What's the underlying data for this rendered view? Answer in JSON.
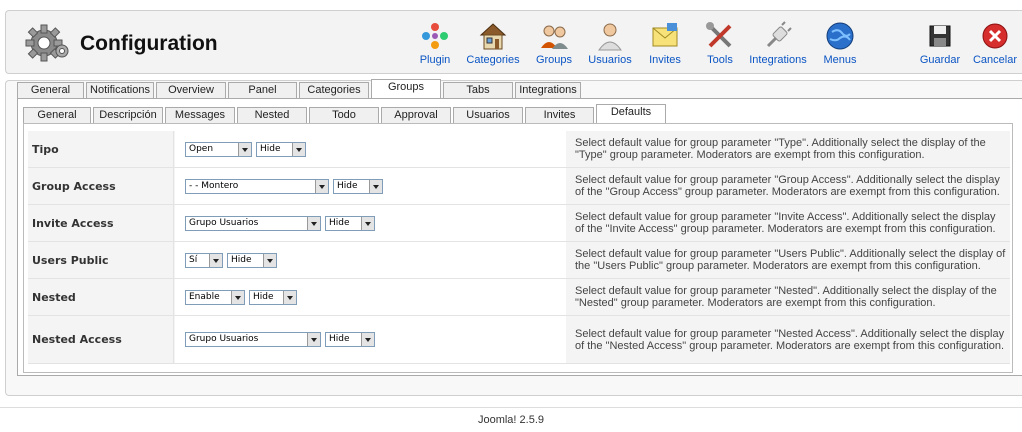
{
  "app": {
    "title": "Configuration",
    "footer": "Joomla! 2.5.9"
  },
  "toolbar": [
    {
      "label": "Plugin",
      "icon": "plugin-icon"
    },
    {
      "label": "Categories",
      "icon": "categories-icon"
    },
    {
      "label": "Groups",
      "icon": "groups-icon"
    },
    {
      "label": "Usuarios",
      "icon": "users-icon"
    },
    {
      "label": "Invites",
      "icon": "invites-icon"
    },
    {
      "label": "Tools",
      "icon": "tools-icon"
    },
    {
      "label": "Integrations",
      "icon": "integrations-icon"
    },
    {
      "label": "Menus",
      "icon": "menus-icon"
    },
    {
      "label": "Guardar",
      "icon": "save-icon"
    },
    {
      "label": "Cancelar",
      "icon": "cancel-icon"
    }
  ],
  "main_tabs": [
    {
      "label": "General"
    },
    {
      "label": "Notifications"
    },
    {
      "label": "Overview"
    },
    {
      "label": "Panel"
    },
    {
      "label": "Categories"
    },
    {
      "label": "Groups",
      "active": true
    },
    {
      "label": "Tabs"
    },
    {
      "label": "Integrations"
    }
  ],
  "sub_tabs": [
    {
      "label": "General"
    },
    {
      "label": "Descripción"
    },
    {
      "label": "Messages"
    },
    {
      "label": "Nested"
    },
    {
      "label": "Todo"
    },
    {
      "label": "Approval"
    },
    {
      "label": "Usuarios"
    },
    {
      "label": "Invites"
    },
    {
      "label": "Defaults",
      "active": true
    }
  ],
  "rows": [
    {
      "label": "Tipo",
      "value": "Open",
      "display": "Hide",
      "desc": "Select default value for group parameter \"Type\". Additionally select the display of the \"Type\" group parameter. Moderators are exempt from this configuration."
    },
    {
      "label": "Group Access",
      "value": "- - Montero",
      "display": "Hide",
      "desc": "Select default value for group parameter \"Group Access\". Additionally select the display of the \"Group Access\" group parameter. Moderators are exempt from this configuration."
    },
    {
      "label": "Invite Access",
      "value": "Grupo Usuarios",
      "display": "Hide",
      "desc": "Select default value for group parameter \"Invite Access\". Additionally select the display of the \"Invite Access\" group parameter. Moderators are exempt from this configuration."
    },
    {
      "label": "Users Public",
      "value": "Sí",
      "display": "Hide",
      "desc": "Select default value for group parameter \"Users Public\". Additionally select the display of the \"Users Public\" group parameter. Moderators are exempt from this configuration."
    },
    {
      "label": "Nested",
      "value": "Enable",
      "display": "Hide",
      "desc": "Select default value for group parameter \"Nested\". Additionally select the display of the \"Nested\" group parameter. Moderators are exempt from this configuration."
    },
    {
      "label": "Nested Access",
      "value": "Grupo Usuarios",
      "display": "Hide",
      "desc": "Select default value for group parameter \"Nested Access\". Additionally select the display of the \"Nested Access\" group parameter. Moderators are exempt from this configuration."
    }
  ]
}
